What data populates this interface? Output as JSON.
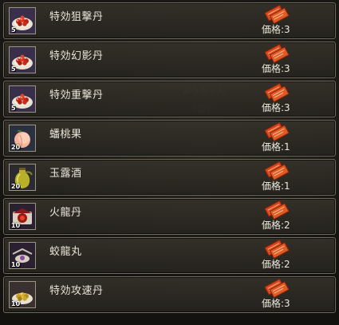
{
  "watermark": {
    "line1": "ようちゃん",
    "line2": "《菌》"
  },
  "items": [
    {
      "name": "特効狙撃丹",
      "qty": "5",
      "price": "価格:3",
      "icon": "red-pills-plate-icon"
    },
    {
      "name": "特効幻影丹",
      "qty": "5",
      "price": "価格:3",
      "icon": "red-pills-plate-icon"
    },
    {
      "name": "特効重撃丹",
      "qty": "5",
      "price": "価格:3",
      "icon": "red-pills-plate-icon"
    },
    {
      "name": "蟠桃果",
      "qty": "20",
      "price": "価格:1",
      "icon": "peach-icon"
    },
    {
      "name": "玉露酒",
      "qty": "20",
      "price": "価格:1",
      "icon": "wine-jug-icon"
    },
    {
      "name": "火龍丹",
      "qty": "10",
      "price": "価格:2",
      "icon": "fire-dragon-pill-icon"
    },
    {
      "name": "蛟龍丸",
      "qty": "10",
      "price": "価格:2",
      "icon": "flood-dragon-pill-icon"
    },
    {
      "name": "特効攻速丹",
      "qty": "10",
      "price": "価格:3",
      "icon": "yellow-pills-plate-icon"
    }
  ],
  "colors": {
    "ticket": "#d8481c",
    "ticket_dark": "#8a2208",
    "row_border": "#6e6a5e",
    "text": "#e8e4d8"
  }
}
